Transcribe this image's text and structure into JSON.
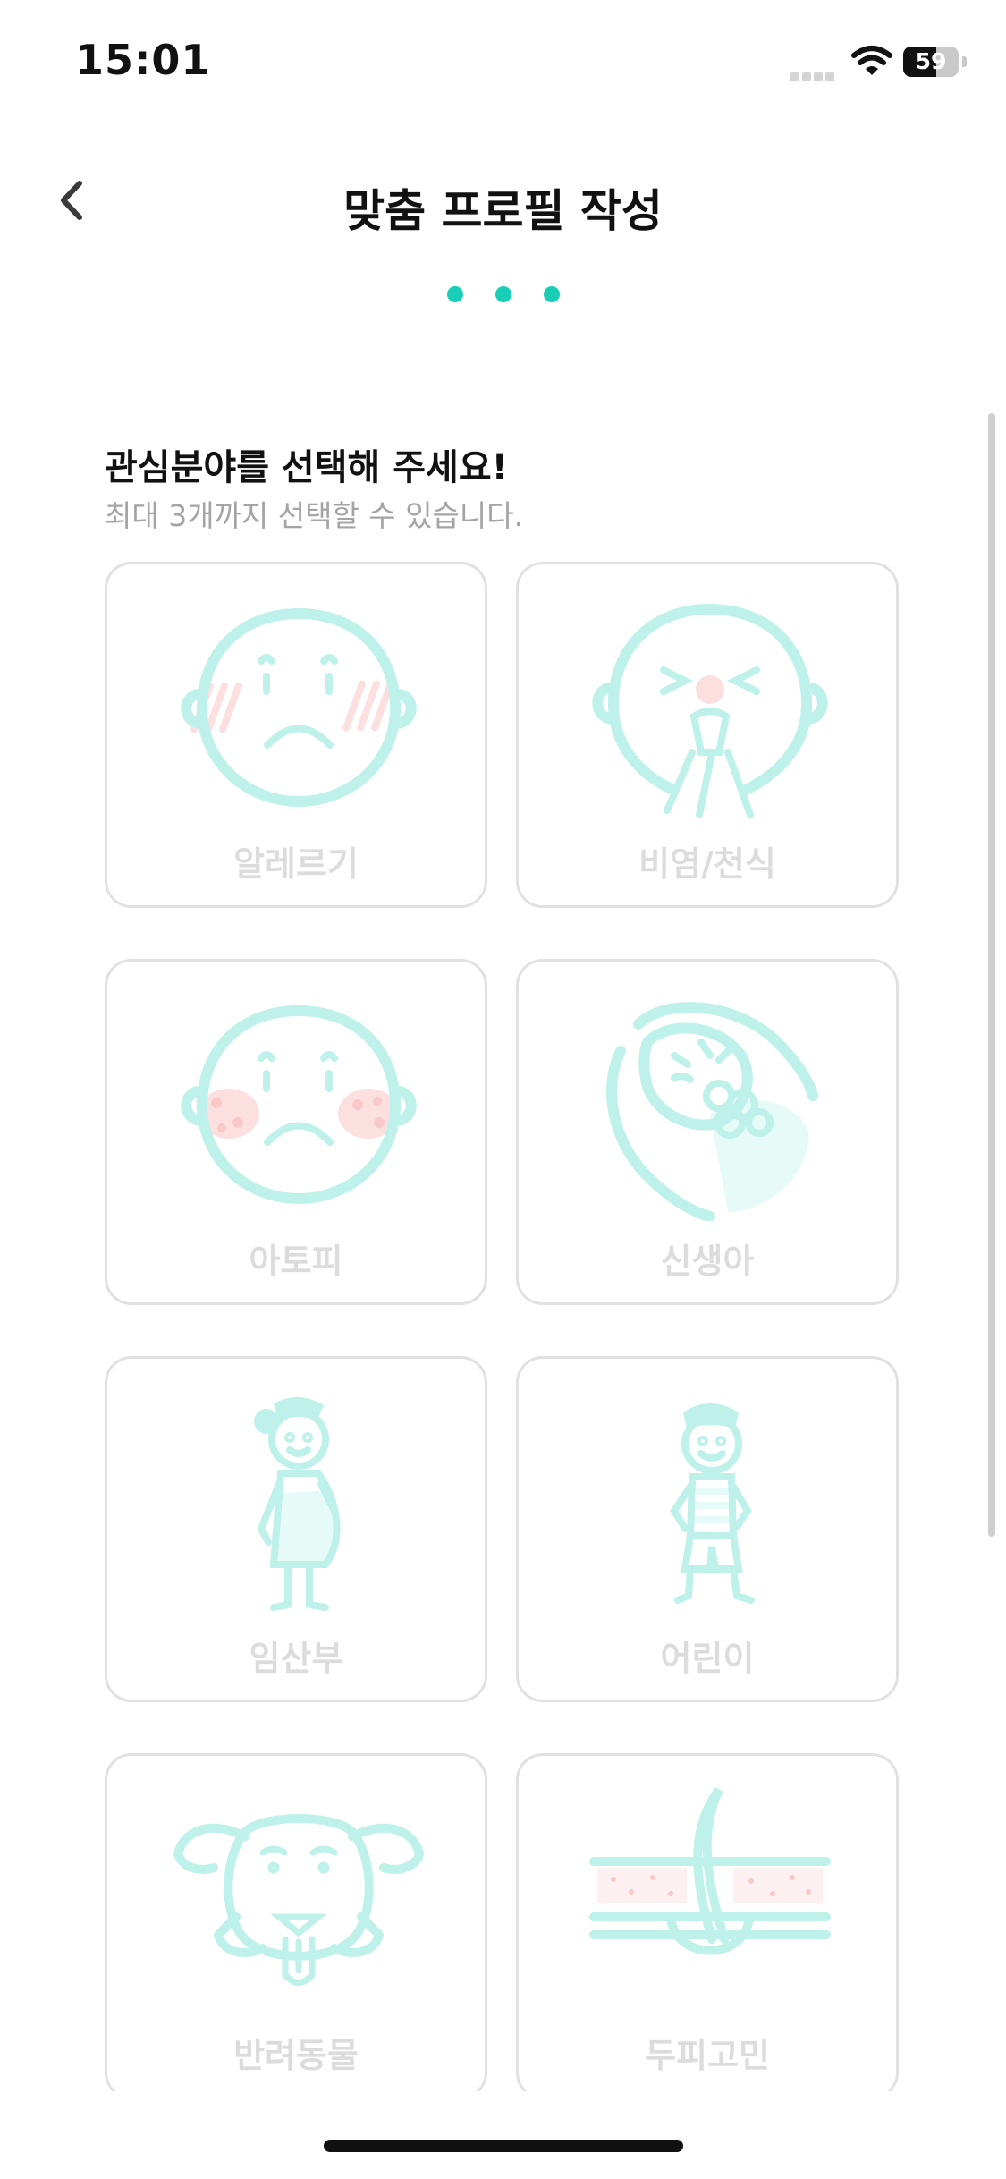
{
  "status_bar": {
    "time": "15:01",
    "battery_percent": "59",
    "battery_level": 0.59,
    "wifi_icon": "wifi-icon",
    "signal_icon": "cellular-signal-icon"
  },
  "header": {
    "title": "맞춤 프로필 작성",
    "back_icon": "chevron-left-icon",
    "steps_total": 3,
    "accent_color": "#19CDB6"
  },
  "section": {
    "heading": "관심분야를 선택해 주세요!",
    "subheading": "최대 3개까지 선택할 수 있습니다."
  },
  "categories": [
    {
      "label": "알레르기",
      "icon": "allergy-face-icon"
    },
    {
      "label": "비염/천식",
      "icon": "sneeze-face-icon"
    },
    {
      "label": "아토피",
      "icon": "atopy-face-icon"
    },
    {
      "label": "신생아",
      "icon": "newborn-baby-icon"
    },
    {
      "label": "임산부",
      "icon": "pregnant-woman-icon"
    },
    {
      "label": "어린이",
      "icon": "child-icon"
    },
    {
      "label": "반려동물",
      "icon": "dog-icon"
    },
    {
      "label": "두피고민",
      "icon": "scalp-hair-icon"
    }
  ],
  "colors": {
    "icon_teal": "#BDF1EA",
    "icon_pink": "#FCE0E0",
    "card_border": "#E1E1E1",
    "label_disabled": "#DCDCDC"
  }
}
